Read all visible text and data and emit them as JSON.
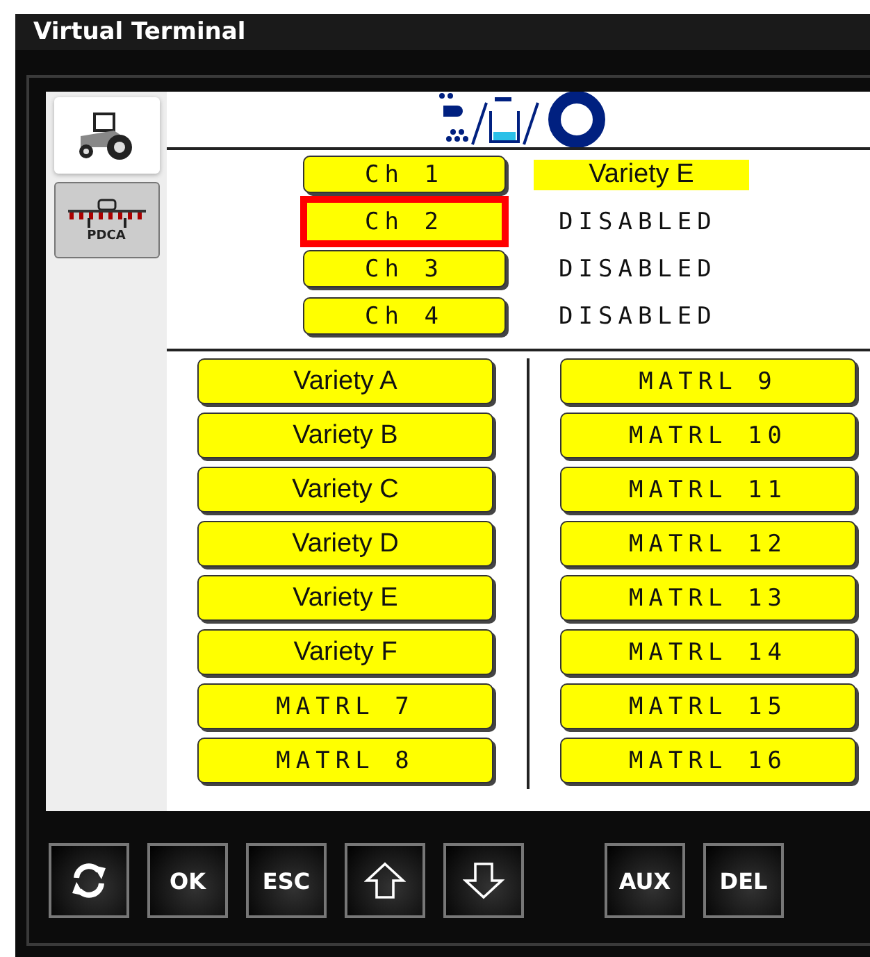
{
  "window": {
    "title": "Virtual Terminal"
  },
  "side_tabs": [
    {
      "kind": "tractor",
      "selected": true
    },
    {
      "kind": "implement",
      "label": "PDCA",
      "selected": false
    }
  ],
  "channels": [
    {
      "label": "Ch 1",
      "selected": false,
      "value": "Variety E",
      "highlighted": true
    },
    {
      "label": "Ch 2",
      "selected": true,
      "value": "DISABLED",
      "highlighted": false
    },
    {
      "label": "Ch 3",
      "selected": false,
      "value": "DISABLED",
      "highlighted": false
    },
    {
      "label": "Ch 4",
      "selected": false,
      "value": "DISABLED",
      "highlighted": false
    }
  ],
  "materials_left": [
    {
      "label": "Variety A",
      "kind": "variety"
    },
    {
      "label": "Variety B",
      "kind": "variety"
    },
    {
      "label": "Variety C",
      "kind": "variety"
    },
    {
      "label": "Variety D",
      "kind": "variety"
    },
    {
      "label": "Variety E",
      "kind": "variety"
    },
    {
      "label": "Variety F",
      "kind": "variety"
    },
    {
      "label": "MATRL 7",
      "kind": "matrl"
    },
    {
      "label": "MATRL 8",
      "kind": "matrl"
    }
  ],
  "materials_right": [
    {
      "label": "MATRL 9",
      "kind": "matrl"
    },
    {
      "label": "MATRL 10",
      "kind": "matrl"
    },
    {
      "label": "MATRL 11",
      "kind": "matrl"
    },
    {
      "label": "MATRL 12",
      "kind": "matrl"
    },
    {
      "label": "MATRL 13",
      "kind": "matrl"
    },
    {
      "label": "MATRL 14",
      "kind": "matrl"
    },
    {
      "label": "MATRL 15",
      "kind": "matrl"
    },
    {
      "label": "MATRL 16",
      "kind": "matrl"
    }
  ],
  "soft_keys": [
    {
      "kind": "refresh"
    },
    {
      "kind": "text",
      "label": "OK"
    },
    {
      "kind": "text",
      "label": "ESC"
    },
    {
      "kind": "up"
    },
    {
      "kind": "down"
    },
    {
      "kind": "gap"
    },
    {
      "kind": "text",
      "label": "AUX"
    },
    {
      "kind": "text",
      "label": "DEL"
    }
  ]
}
